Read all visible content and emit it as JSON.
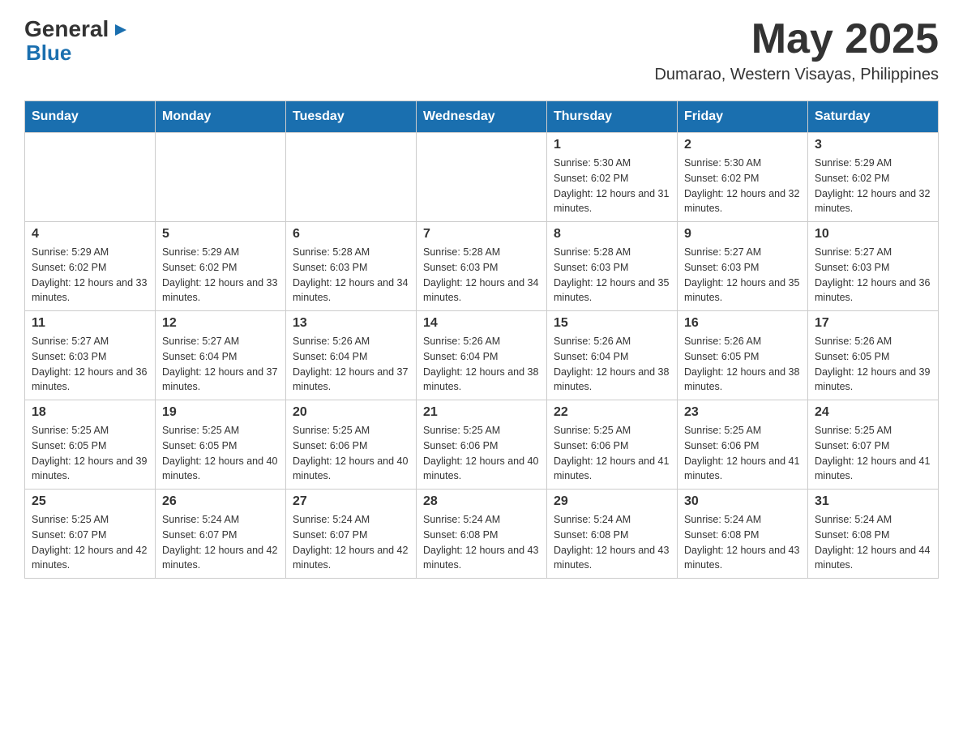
{
  "header": {
    "logo": {
      "text_general": "General",
      "triangle": "▶",
      "text_blue": "Blue"
    },
    "month_title": "May 2025",
    "location": "Dumarao, Western Visayas, Philippines"
  },
  "calendar": {
    "days_of_week": [
      "Sunday",
      "Monday",
      "Tuesday",
      "Wednesday",
      "Thursday",
      "Friday",
      "Saturday"
    ],
    "weeks": [
      [
        {
          "day": "",
          "sunrise": "",
          "sunset": "",
          "daylight": ""
        },
        {
          "day": "",
          "sunrise": "",
          "sunset": "",
          "daylight": ""
        },
        {
          "day": "",
          "sunrise": "",
          "sunset": "",
          "daylight": ""
        },
        {
          "day": "",
          "sunrise": "",
          "sunset": "",
          "daylight": ""
        },
        {
          "day": "1",
          "sunrise": "Sunrise: 5:30 AM",
          "sunset": "Sunset: 6:02 PM",
          "daylight": "Daylight: 12 hours and 31 minutes."
        },
        {
          "day": "2",
          "sunrise": "Sunrise: 5:30 AM",
          "sunset": "Sunset: 6:02 PM",
          "daylight": "Daylight: 12 hours and 32 minutes."
        },
        {
          "day": "3",
          "sunrise": "Sunrise: 5:29 AM",
          "sunset": "Sunset: 6:02 PM",
          "daylight": "Daylight: 12 hours and 32 minutes."
        }
      ],
      [
        {
          "day": "4",
          "sunrise": "Sunrise: 5:29 AM",
          "sunset": "Sunset: 6:02 PM",
          "daylight": "Daylight: 12 hours and 33 minutes."
        },
        {
          "day": "5",
          "sunrise": "Sunrise: 5:29 AM",
          "sunset": "Sunset: 6:02 PM",
          "daylight": "Daylight: 12 hours and 33 minutes."
        },
        {
          "day": "6",
          "sunrise": "Sunrise: 5:28 AM",
          "sunset": "Sunset: 6:03 PM",
          "daylight": "Daylight: 12 hours and 34 minutes."
        },
        {
          "day": "7",
          "sunrise": "Sunrise: 5:28 AM",
          "sunset": "Sunset: 6:03 PM",
          "daylight": "Daylight: 12 hours and 34 minutes."
        },
        {
          "day": "8",
          "sunrise": "Sunrise: 5:28 AM",
          "sunset": "Sunset: 6:03 PM",
          "daylight": "Daylight: 12 hours and 35 minutes."
        },
        {
          "day": "9",
          "sunrise": "Sunrise: 5:27 AM",
          "sunset": "Sunset: 6:03 PM",
          "daylight": "Daylight: 12 hours and 35 minutes."
        },
        {
          "day": "10",
          "sunrise": "Sunrise: 5:27 AM",
          "sunset": "Sunset: 6:03 PM",
          "daylight": "Daylight: 12 hours and 36 minutes."
        }
      ],
      [
        {
          "day": "11",
          "sunrise": "Sunrise: 5:27 AM",
          "sunset": "Sunset: 6:03 PM",
          "daylight": "Daylight: 12 hours and 36 minutes."
        },
        {
          "day": "12",
          "sunrise": "Sunrise: 5:27 AM",
          "sunset": "Sunset: 6:04 PM",
          "daylight": "Daylight: 12 hours and 37 minutes."
        },
        {
          "day": "13",
          "sunrise": "Sunrise: 5:26 AM",
          "sunset": "Sunset: 6:04 PM",
          "daylight": "Daylight: 12 hours and 37 minutes."
        },
        {
          "day": "14",
          "sunrise": "Sunrise: 5:26 AM",
          "sunset": "Sunset: 6:04 PM",
          "daylight": "Daylight: 12 hours and 38 minutes."
        },
        {
          "day": "15",
          "sunrise": "Sunrise: 5:26 AM",
          "sunset": "Sunset: 6:04 PM",
          "daylight": "Daylight: 12 hours and 38 minutes."
        },
        {
          "day": "16",
          "sunrise": "Sunrise: 5:26 AM",
          "sunset": "Sunset: 6:05 PM",
          "daylight": "Daylight: 12 hours and 38 minutes."
        },
        {
          "day": "17",
          "sunrise": "Sunrise: 5:26 AM",
          "sunset": "Sunset: 6:05 PM",
          "daylight": "Daylight: 12 hours and 39 minutes."
        }
      ],
      [
        {
          "day": "18",
          "sunrise": "Sunrise: 5:25 AM",
          "sunset": "Sunset: 6:05 PM",
          "daylight": "Daylight: 12 hours and 39 minutes."
        },
        {
          "day": "19",
          "sunrise": "Sunrise: 5:25 AM",
          "sunset": "Sunset: 6:05 PM",
          "daylight": "Daylight: 12 hours and 40 minutes."
        },
        {
          "day": "20",
          "sunrise": "Sunrise: 5:25 AM",
          "sunset": "Sunset: 6:06 PM",
          "daylight": "Daylight: 12 hours and 40 minutes."
        },
        {
          "day": "21",
          "sunrise": "Sunrise: 5:25 AM",
          "sunset": "Sunset: 6:06 PM",
          "daylight": "Daylight: 12 hours and 40 minutes."
        },
        {
          "day": "22",
          "sunrise": "Sunrise: 5:25 AM",
          "sunset": "Sunset: 6:06 PM",
          "daylight": "Daylight: 12 hours and 41 minutes."
        },
        {
          "day": "23",
          "sunrise": "Sunrise: 5:25 AM",
          "sunset": "Sunset: 6:06 PM",
          "daylight": "Daylight: 12 hours and 41 minutes."
        },
        {
          "day": "24",
          "sunrise": "Sunrise: 5:25 AM",
          "sunset": "Sunset: 6:07 PM",
          "daylight": "Daylight: 12 hours and 41 minutes."
        }
      ],
      [
        {
          "day": "25",
          "sunrise": "Sunrise: 5:25 AM",
          "sunset": "Sunset: 6:07 PM",
          "daylight": "Daylight: 12 hours and 42 minutes."
        },
        {
          "day": "26",
          "sunrise": "Sunrise: 5:24 AM",
          "sunset": "Sunset: 6:07 PM",
          "daylight": "Daylight: 12 hours and 42 minutes."
        },
        {
          "day": "27",
          "sunrise": "Sunrise: 5:24 AM",
          "sunset": "Sunset: 6:07 PM",
          "daylight": "Daylight: 12 hours and 42 minutes."
        },
        {
          "day": "28",
          "sunrise": "Sunrise: 5:24 AM",
          "sunset": "Sunset: 6:08 PM",
          "daylight": "Daylight: 12 hours and 43 minutes."
        },
        {
          "day": "29",
          "sunrise": "Sunrise: 5:24 AM",
          "sunset": "Sunset: 6:08 PM",
          "daylight": "Daylight: 12 hours and 43 minutes."
        },
        {
          "day": "30",
          "sunrise": "Sunrise: 5:24 AM",
          "sunset": "Sunset: 6:08 PM",
          "daylight": "Daylight: 12 hours and 43 minutes."
        },
        {
          "day": "31",
          "sunrise": "Sunrise: 5:24 AM",
          "sunset": "Sunset: 6:08 PM",
          "daylight": "Daylight: 12 hours and 44 minutes."
        }
      ]
    ]
  }
}
